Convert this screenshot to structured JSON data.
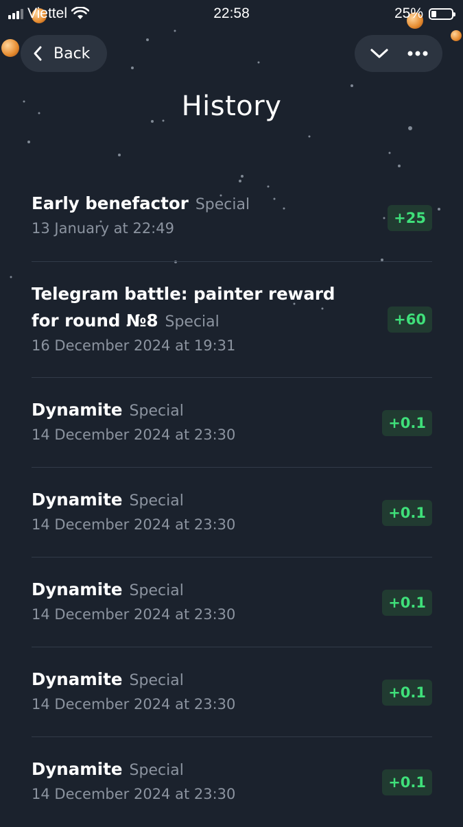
{
  "status_bar": {
    "carrier": "Viettel",
    "time": "22:58",
    "battery": "25%",
    "battery_level": 0.25
  },
  "header": {
    "back_label": "Back",
    "title": "History",
    "chevron_icon": "chevron-down-icon",
    "more_icon": "more-horizontal-icon"
  },
  "history": [
    {
      "name": "Early benefactor",
      "tag": "Special",
      "date": "13 January at 22:49",
      "amount": "+25"
    },
    {
      "name": "Telegram battle: painter reward for round №8",
      "tag": "Special",
      "date": "16 December 2024 at 19:31",
      "amount": "+60"
    },
    {
      "name": "Dynamite",
      "tag": "Special",
      "date": "14 December 2024 at 23:30",
      "amount": "+0.1"
    },
    {
      "name": "Dynamite",
      "tag": "Special",
      "date": "14 December 2024 at 23:30",
      "amount": "+0.1"
    },
    {
      "name": "Dynamite",
      "tag": "Special",
      "date": "14 December 2024 at 23:30",
      "amount": "+0.1"
    },
    {
      "name": "Dynamite",
      "tag": "Special",
      "date": "14 December 2024 at 23:30",
      "amount": "+0.1"
    },
    {
      "name": "Dynamite",
      "tag": "Special",
      "date": "14 December 2024 at 23:30",
      "amount": "+0.1"
    }
  ],
  "colors": {
    "background": "#1b222d",
    "pill": "#2c3440",
    "badge_bg": "#213b31",
    "badge_text": "#3fe07a",
    "secondary_text": "#8c94a0"
  }
}
